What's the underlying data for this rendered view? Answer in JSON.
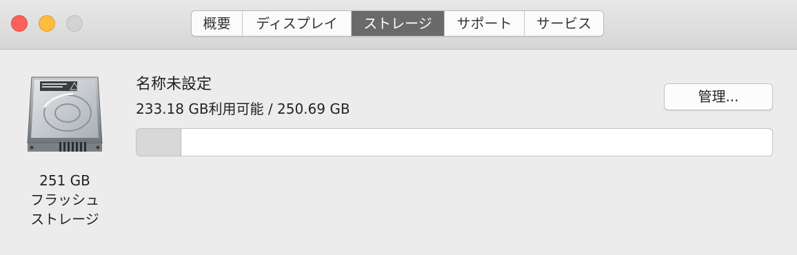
{
  "window": {
    "traffic_lights": {
      "close_color": "#fc605b",
      "minimize_color": "#fdbc40",
      "zoom_color": "#d3d3d3"
    }
  },
  "tabs": [
    {
      "label": "概要",
      "active": false
    },
    {
      "label": "ディスプレイ",
      "active": false
    },
    {
      "label": "ストレージ",
      "active": true
    },
    {
      "label": "サポート",
      "active": false
    },
    {
      "label": "サービス",
      "active": false
    }
  ],
  "disk": {
    "icon": "hard-drive-icon",
    "size_label": "251 GB",
    "type_line1": "フラッシュ",
    "type_line2": "ストレージ",
    "name": "名称未設定",
    "capacity_text": "233.18 GB利用可能 / 250.69 GB",
    "manage_label": "管理...",
    "available_gb": 233.18,
    "total_gb": 250.69,
    "used_fraction": 0.07,
    "used_color": "#d8d8d8"
  }
}
